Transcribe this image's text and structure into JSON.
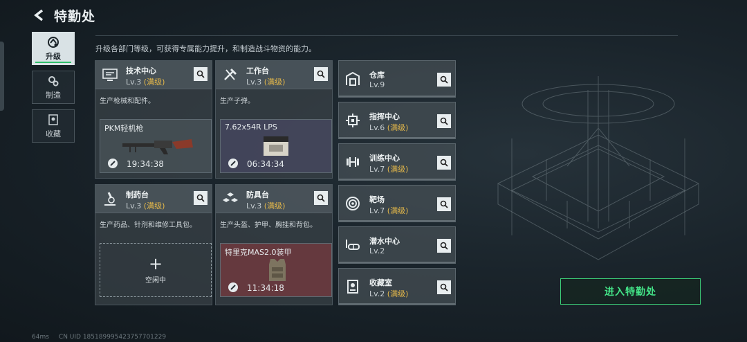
{
  "header": {
    "title": "特勤处"
  },
  "subtitle": "升级各部门等级，可获得专属能力提升，和制造战斗物资的能力。",
  "nav": [
    {
      "label": "升级",
      "icon": "upgrade-icon",
      "active": true
    },
    {
      "label": "制造",
      "icon": "craft-gears-icon",
      "active": false
    },
    {
      "label": "收藏",
      "icon": "collection-icon",
      "active": false
    }
  ],
  "departments": [
    {
      "name": "技术中心",
      "level": "Lv.3",
      "max_tag": "(满级)",
      "desc": "生产枪械和配件。",
      "icon": "tech-center-icon",
      "slot": {
        "item": "PKM轻机枪",
        "time": "19:34:38"
      }
    },
    {
      "name": "工作台",
      "level": "Lv.3",
      "max_tag": "(满级)",
      "desc": "生产子弹。",
      "icon": "workbench-tools-icon",
      "slot": {
        "item": "7.62x54R LPS",
        "time": "06:34:34"
      }
    },
    {
      "name": "制药台",
      "level": "Lv.3",
      "max_tag": "(满级)",
      "desc": "生产药品、针剂和维修工具包。",
      "icon": "microscope-icon",
      "slot": {
        "empty_label": "空闲中"
      }
    },
    {
      "name": "防具台",
      "level": "Lv.3",
      "max_tag": "(满级)",
      "desc": "生产头盔、护甲、胸挂和背包。",
      "icon": "armor-boxes-icon",
      "slot": {
        "item": "特里克MAS2.0装甲",
        "time": "11:34:18"
      }
    }
  ],
  "side_departments": [
    {
      "name": "仓库",
      "level": "Lv.9",
      "max_tag": "",
      "icon": "warehouse-icon"
    },
    {
      "name": "指挥中心",
      "level": "Lv.6",
      "max_tag": "(满级)",
      "icon": "command-chip-icon"
    },
    {
      "name": "训练中心",
      "level": "Lv.7",
      "max_tag": "(满级)",
      "icon": "dumbbell-icon"
    },
    {
      "name": "靶场",
      "level": "Lv.7",
      "max_tag": "(满级)",
      "icon": "target-icon"
    },
    {
      "name": "潜水中心",
      "level": "Lv.2",
      "max_tag": "",
      "icon": "diving-mask-icon"
    },
    {
      "name": "收藏室",
      "level": "Lv.2",
      "max_tag": "(满级)",
      "icon": "collection-room-icon"
    }
  ],
  "enter_button": "进入特勤处",
  "footer": {
    "ping": "64ms",
    "uid": "CN UID 18518999542375770​1229"
  },
  "colors": {
    "accent_green": "#43e287",
    "max_gold": "#e4b84a"
  }
}
